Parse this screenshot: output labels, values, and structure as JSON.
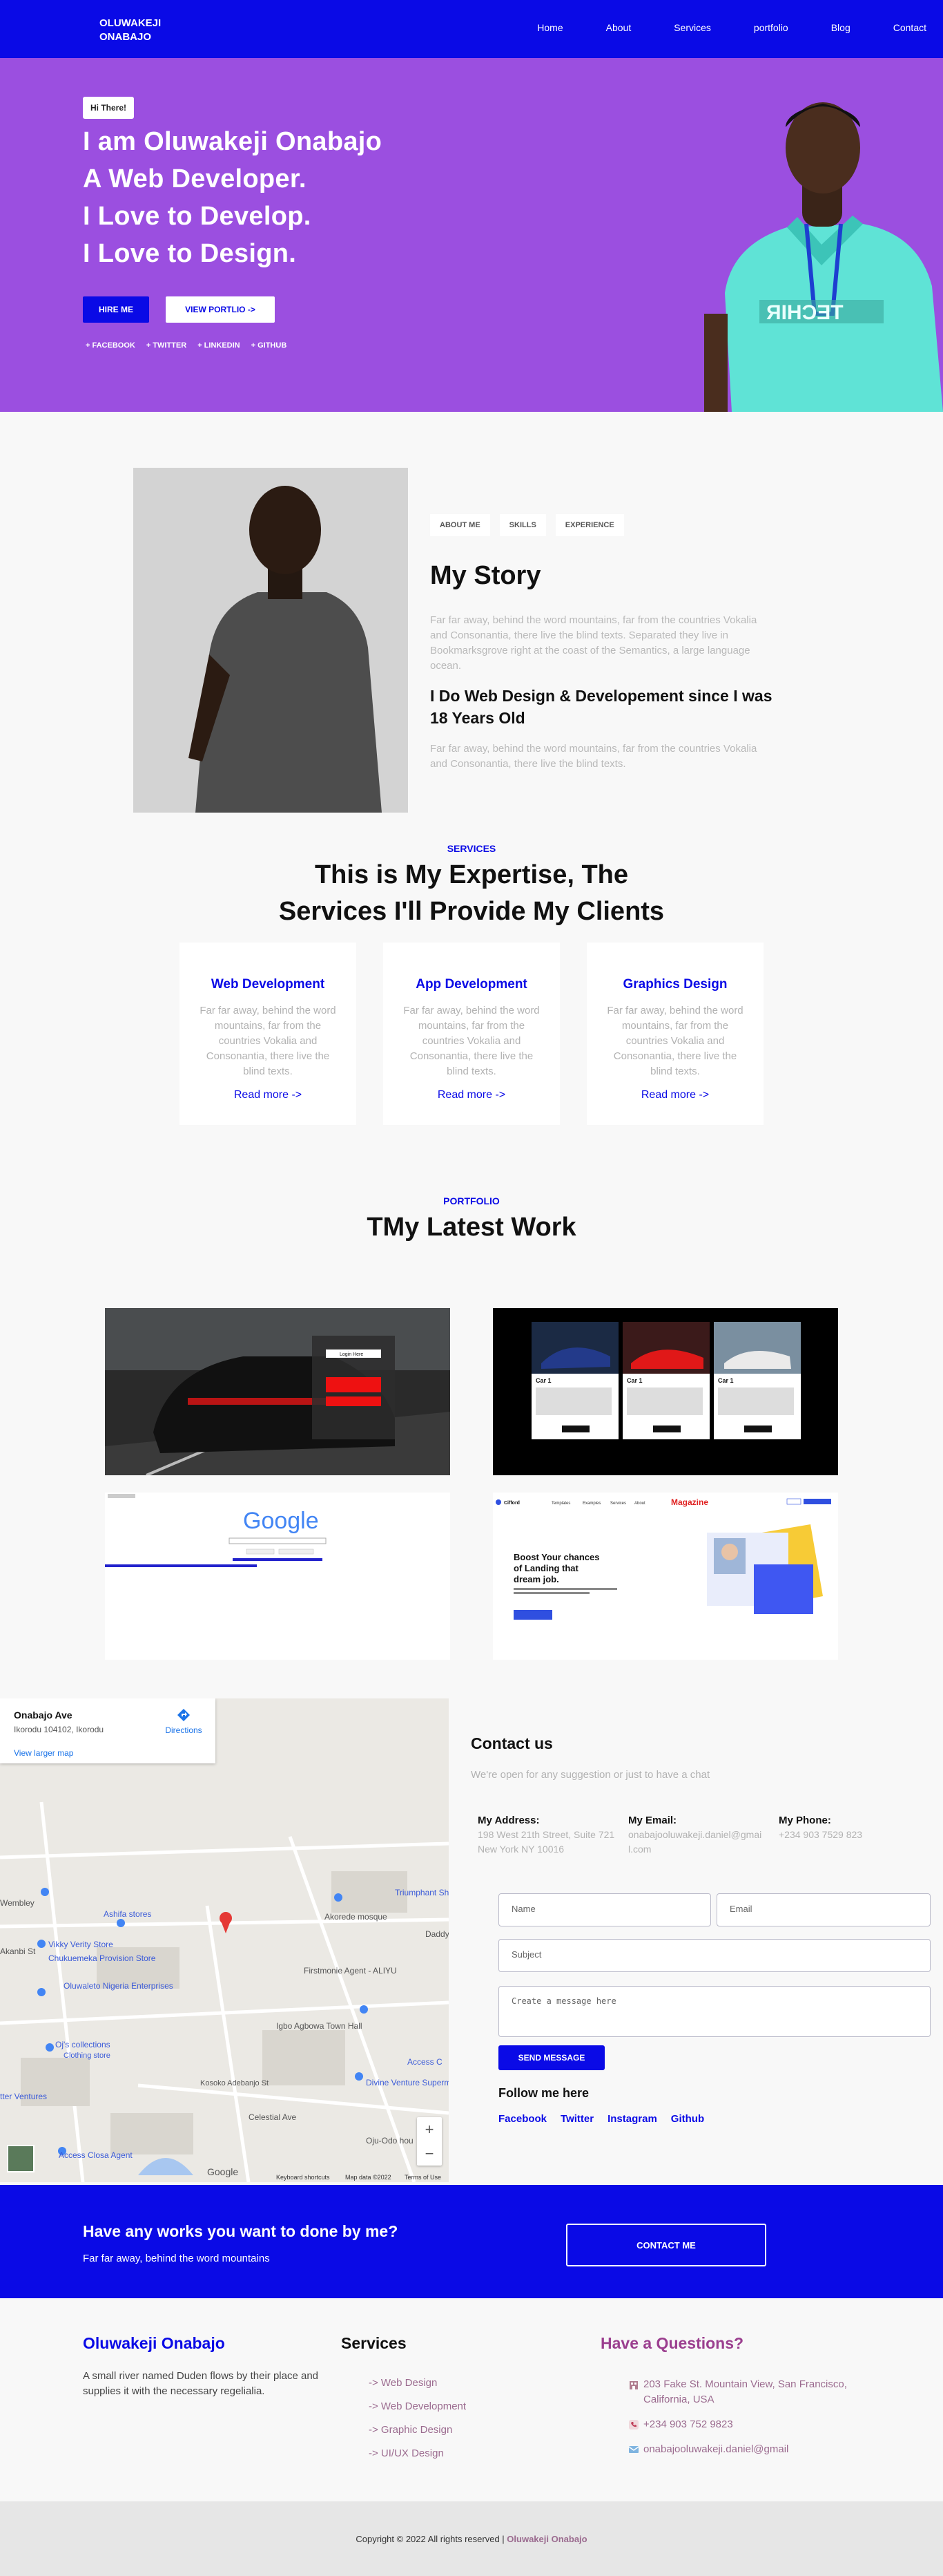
{
  "header": {
    "brand": "OLUWAKEJI\nONABAJO",
    "brand_line1": "OLUWAKEJI",
    "brand_line2": "ONABAJO",
    "nav": [
      "Home",
      "About",
      "Services",
      "portfolio",
      "Blog",
      "Contact"
    ]
  },
  "hero": {
    "badge": "Hi There!",
    "lines": [
      "I am Oluwakeji Onabajo",
      "A Web Developer.",
      "I Love to Develop.",
      "I Love to Design."
    ],
    "hire_label": "HIRE ME",
    "portfolio_label": "VIEW PORTLIO ->",
    "socials": [
      "+ FACEBOOK",
      "+ TWITTER",
      "+ LINKEDIN",
      "+ GITHUB"
    ]
  },
  "about": {
    "tabs": [
      "ABOUT ME",
      "SKILLS",
      "EXPERIENCE"
    ],
    "title": "My Story",
    "p1": "Far far away, behind the word mountains, far from the countries Vokalia and Consonantia, there live the blind texts. Separated they live in Bookmarksgrove right at the coast of the Semantics, a large language ocean.",
    "subtitle": "I Do Web Design & Developement since I was 18 Years Old",
    "p2": "Far far away, behind the word mountains, far from the countries Vokalia and Consonantia, there live the blind texts."
  },
  "services": {
    "kicker": "SERVICES",
    "title_line1": "This is My Expertise, The",
    "title_line2": "Services I'll Provide My Clients",
    "cards": [
      {
        "title": "Web Development",
        "text": "Far far away, behind the word mountains, far from the countries Vokalia and Consonantia, there live the blind texts.",
        "link": "Read more ->"
      },
      {
        "title": "App Development",
        "text": "Far far away, behind the word mountains, far from the countries Vokalia and Consonantia, there live the blind texts.",
        "link": "Read more ->"
      },
      {
        "title": "Graphics Design",
        "text": "Far far away, behind the word mountains, far from the countries Vokalia and Consonantia, there live the blind texts.",
        "link": "Read more ->"
      }
    ]
  },
  "portfolio": {
    "kicker": "PORTFOLIO",
    "title": "TMy Latest Work",
    "car_form_button": "Login Here",
    "cars_card_title": "Car 1",
    "google_logo": "Google",
    "magazine": {
      "logo": "Cifford",
      "brand": "Magazine",
      "nav": [
        "Templates",
        "Examples",
        "Services",
        "About"
      ],
      "headline": "Boost Your chances of Landing that dream job.",
      "button": "Create CV Now"
    }
  },
  "map": {
    "place": "Onabajo Ave",
    "address": "Ikorodu 104102, Ikorodu",
    "directions": "Directions",
    "larger_map": "View larger map",
    "labels": [
      "Ashifa stores",
      "Vikky Verity Store",
      "Chukuemeka Provision Store",
      "Oluwaleto Nigeria Enterprises",
      "Oj's collections",
      "Wembley",
      "Akorede mosque",
      "Triumphant Shopping mall",
      "Firstmonie Agent - ALIYU",
      "Igbo Agbowa Town Hall",
      "Divine Venture Supermarket",
      "Access Closa Agent",
      "Oju-Odo hou",
      "Access C",
      "tter Ventures",
      "Celestial Ave",
      "Daddy",
      "Akanbi St",
      "Clothing store",
      "Kosoko Adebanjo St"
    ],
    "footer": [
      "Keyboard shortcuts",
      "Map data ©2022",
      "Terms of Use"
    ],
    "google": "Google"
  },
  "contact": {
    "title": "Contact us",
    "subtitle": "We're open for any suggestion or just to have a chat",
    "address_label": "My Address:",
    "address": "198 West 21th Street, Suite 721 New York NY 10016",
    "email_label": "My Email:",
    "email": "onabajooluwakeji.daniel@gmail.com",
    "phone_label": "My Phone:",
    "phone": "+234 903 7529 823",
    "placeholders": {
      "name": "Name",
      "email": "Email",
      "subject": "Subject",
      "message": "Create a message here"
    },
    "send": "SEND MESSAGE",
    "follow_title": "Follow me here",
    "follow": [
      "Facebook",
      "Twitter",
      "Instagram",
      "Github"
    ]
  },
  "cta": {
    "title": "Have any works you want to done by me?",
    "subtitle": "Far far away, behind the word mountains",
    "button": "CONTACT ME"
  },
  "footer": {
    "brand": "Oluwakeji Onabajo",
    "about": "A small river named Duden flows by their place and supplies it with the necessary regelialia.",
    "services_title": "Services",
    "services": [
      "-> Web Design",
      "-> Web Development",
      "-> Graphic Design",
      "-> UI/UX Design"
    ],
    "questions_title": "Have a Questions?",
    "address": "203 Fake St. Mountain View, San Francisco, California, USA",
    "phone": "+234 903 752 9823",
    "email": "onabajooluwakeji.daniel@gmail",
    "copyright_prefix": "Copyright © 2022 All rights reserved |",
    "copyright_name": "Oluwakeji Onabajo"
  },
  "colors": {
    "accent": "#0a0ae6",
    "hero": "#9b4fe0",
    "footer_link": "#9b6b8f"
  }
}
